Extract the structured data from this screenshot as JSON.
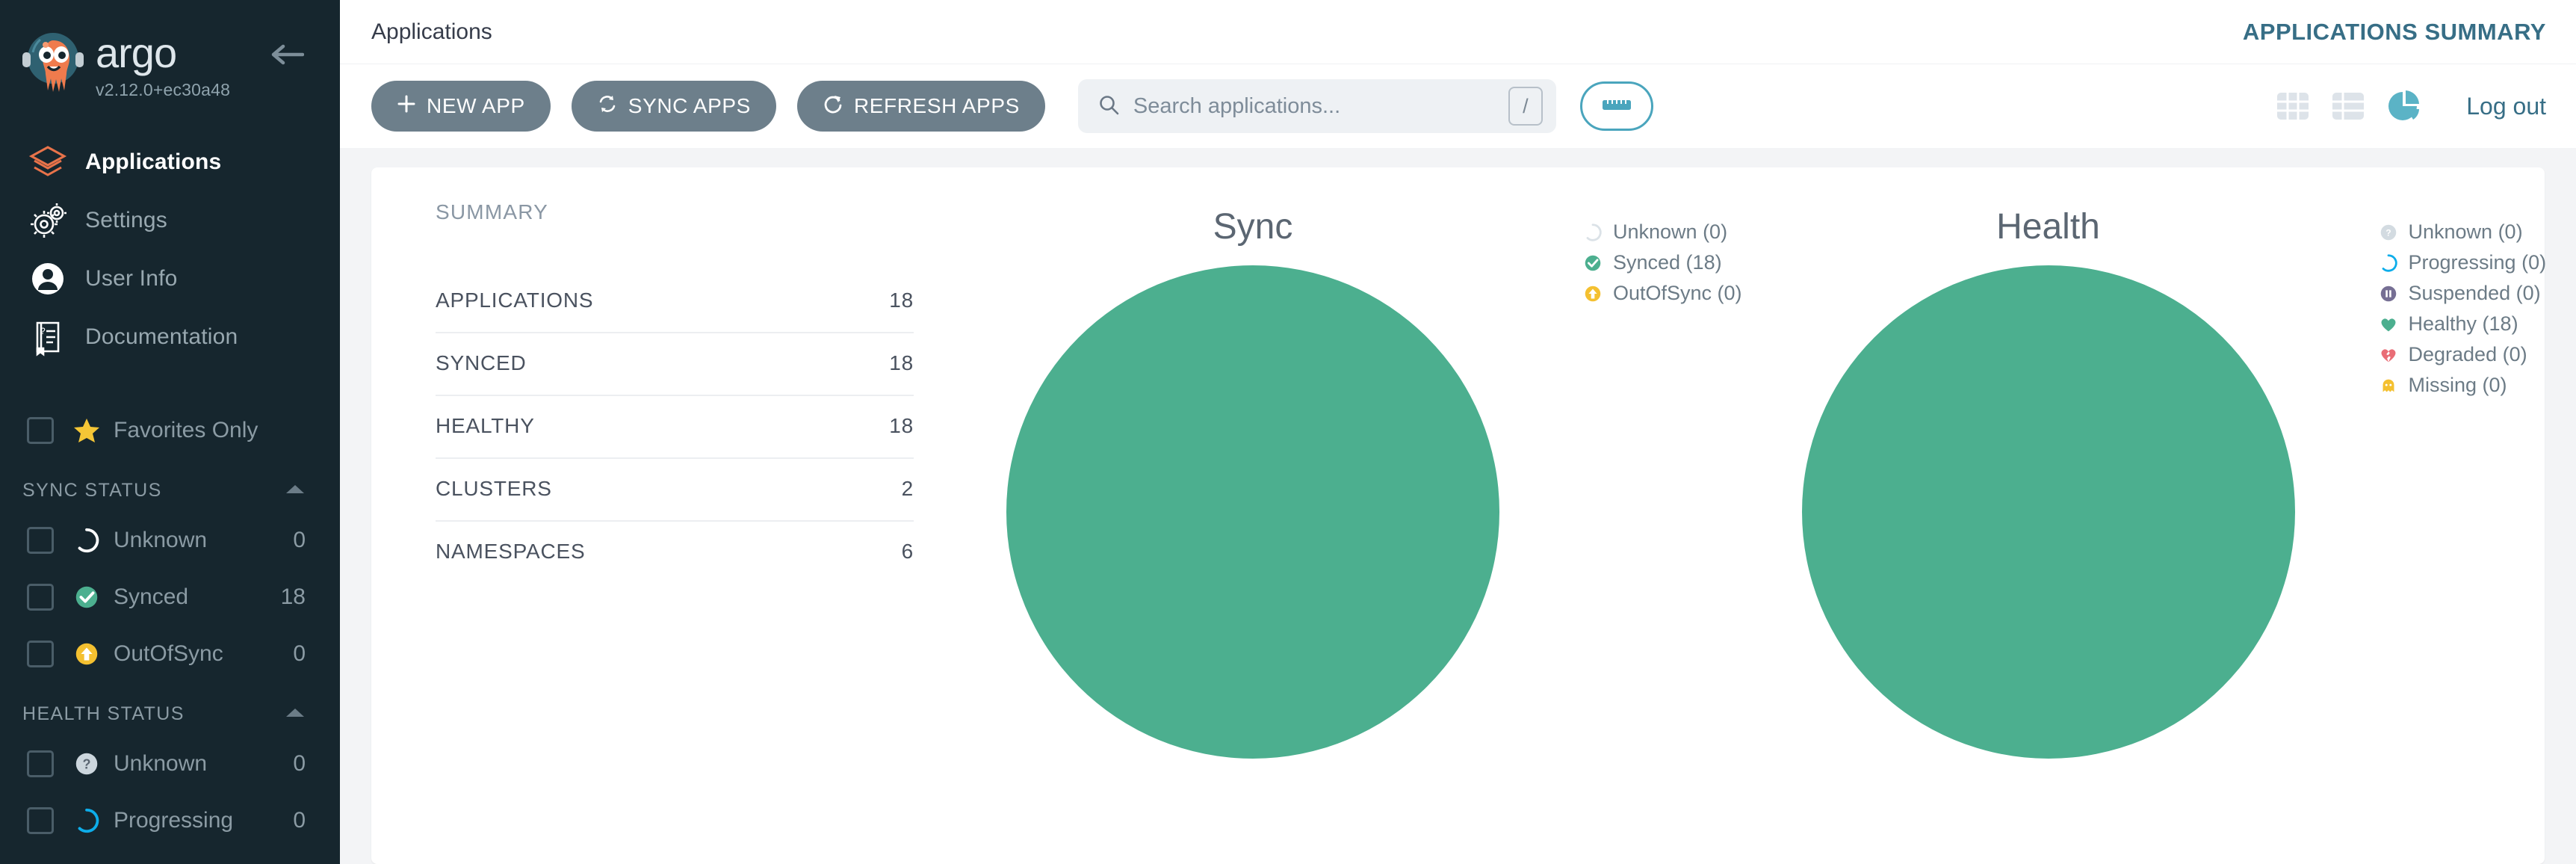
{
  "brand": {
    "name": "argo",
    "version": "v2.12.0+ec30a48",
    "logo_icon": "argo-octopus-logo",
    "collapse_icon": "arrow-left-icon"
  },
  "sidebar": {
    "nav": [
      {
        "label": "Applications",
        "icon": "layers-icon",
        "active": true
      },
      {
        "label": "Settings",
        "icon": "gears-icon",
        "active": false
      },
      {
        "label": "User Info",
        "icon": "user-circle-icon",
        "active": false
      },
      {
        "label": "Documentation",
        "icon": "book-icon",
        "active": false
      }
    ],
    "favorites": {
      "label": "Favorites Only",
      "icon": "star-icon",
      "checked": false
    },
    "sections": [
      {
        "title": "SYNC STATUS",
        "collapse_icon": "chevron-up-icon",
        "items": [
          {
            "label": "Unknown",
            "count": "0",
            "icon": "circle-dashed-icon",
            "color": "#ccd6dd"
          },
          {
            "label": "Synced",
            "count": "18",
            "icon": "check-circle-icon",
            "color": "#4caf8f"
          },
          {
            "label": "OutOfSync",
            "count": "0",
            "icon": "arrow-up-circle-icon",
            "color": "#f4c030"
          }
        ]
      },
      {
        "title": "HEALTH STATUS",
        "collapse_icon": "chevron-up-icon",
        "items": [
          {
            "label": "Unknown",
            "count": "0",
            "icon": "question-circle-icon",
            "color": "#ccd6dd"
          },
          {
            "label": "Progressing",
            "count": "0",
            "icon": "spinner-icon",
            "color": "#0dadea"
          }
        ]
      }
    ]
  },
  "header": {
    "breadcrumb": "Applications",
    "page_title": "APPLICATIONS SUMMARY"
  },
  "toolbar": {
    "new_app": "NEW APP",
    "new_app_icon": "plus-icon",
    "sync_apps": "SYNC APPS",
    "sync_apps_icon": "sync-arrows-icon",
    "refresh_apps": "REFRESH APPS",
    "refresh_apps_icon": "refresh-icon",
    "search_placeholder": "Search applications...",
    "search_value": "",
    "search_icon": "search-icon",
    "search_shortcut": "/",
    "ruler_icon": "ruler-icon",
    "view_tiles_icon": "grid-tiles-icon",
    "view_list_icon": "list-icon",
    "view_pie_icon": "pie-chart-icon",
    "logout": "Log out"
  },
  "summary": {
    "title": "SUMMARY",
    "rows": [
      {
        "label": "APPLICATIONS",
        "value": "18"
      },
      {
        "label": "SYNCED",
        "value": "18"
      },
      {
        "label": "HEALTHY",
        "value": "18"
      },
      {
        "label": "CLUSTERS",
        "value": "2"
      },
      {
        "label": "NAMESPACES",
        "value": "6"
      }
    ]
  },
  "chart_data": [
    {
      "type": "pie",
      "title": "Sync",
      "categories": [
        "Unknown",
        "Synced",
        "OutOfSync"
      ],
      "values": [
        0,
        18,
        0
      ],
      "colors": [
        "#ccd6dd",
        "#4caf8f",
        "#f4c030"
      ],
      "legend_position": "right",
      "legend": [
        {
          "label": "Unknown (0)",
          "icon": "circle-dashed-icon",
          "color": "#dbe2e7"
        },
        {
          "label": "Synced (18)",
          "icon": "check-circle-icon",
          "color": "#4caf8f"
        },
        {
          "label": "OutOfSync (0)",
          "icon": "arrow-up-circle-icon",
          "color": "#f4c030"
        }
      ]
    },
    {
      "type": "pie",
      "title": "Health",
      "categories": [
        "Unknown",
        "Progressing",
        "Suspended",
        "Healthy",
        "Degraded",
        "Missing"
      ],
      "values": [
        0,
        0,
        0,
        18,
        0,
        0
      ],
      "colors": [
        "#ccd6dd",
        "#0dadea",
        "#766f94",
        "#4caf8f",
        "#e96d76",
        "#f4c030"
      ],
      "legend_position": "right",
      "legend": [
        {
          "label": "Unknown (0)",
          "icon": "question-circle-icon",
          "color": "#d3dbe1"
        },
        {
          "label": "Progressing (0)",
          "icon": "spinner-icon",
          "color": "#0dadea"
        },
        {
          "label": "Suspended (0)",
          "icon": "pause-circle-icon",
          "color": "#766f94"
        },
        {
          "label": "Healthy (18)",
          "icon": "heart-icon",
          "color": "#4caf8f"
        },
        {
          "label": "Degraded (0)",
          "icon": "broken-heart-icon",
          "color": "#e96d76"
        },
        {
          "label": "Missing (0)",
          "icon": "ghost-icon",
          "color": "#f4c030"
        }
      ]
    }
  ]
}
